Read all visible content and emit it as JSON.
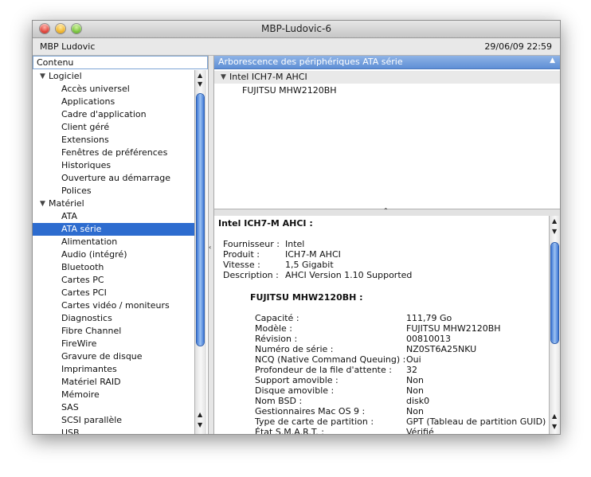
{
  "window": {
    "title": "MBP-Ludovic-6",
    "machine_name": "MBP Ludovic",
    "datetime": "29/06/09 22:59"
  },
  "sidebar": {
    "header": "Contenu",
    "groups": [
      {
        "label": "Logiciel",
        "items": [
          "Accès universel",
          "Applications",
          "Cadre d'application",
          "Client géré",
          "Extensions",
          "Fenêtres de préférences",
          "Historiques",
          "Ouverture au démarrage",
          "Polices"
        ]
      },
      {
        "label": "Matériel",
        "items": [
          "ATA",
          "ATA série",
          "Alimentation",
          "Audio (intégré)",
          "Bluetooth",
          "Cartes PC",
          "Cartes PCI",
          "Cartes vidéo / moniteurs",
          "Diagnostics",
          "Fibre Channel",
          "FireWire",
          "Gravure de disque",
          "Imprimantes",
          "Matériel RAID",
          "Mémoire",
          "SAS",
          "SCSI parallèle",
          "USB"
        ]
      }
    ],
    "selected": "ATA série"
  },
  "top_pane": {
    "header": "Arborescence des périphériques ATA série",
    "controller": "Intel ICH7-M AHCI",
    "device": "FUJITSU MHW2120BH"
  },
  "detail": {
    "title": "Intel ICH7-M AHCI :",
    "controller_props": [
      {
        "label": "Fournisseur :",
        "value": "Intel"
      },
      {
        "label": "Produit :",
        "value": "ICH7-M AHCI"
      },
      {
        "label": "Vitesse :",
        "value": "1,5 Gigabit"
      },
      {
        "label": "Description :",
        "value": "AHCI Version 1.10 Supported"
      }
    ],
    "device_title": "FUJITSU MHW2120BH :",
    "device_props": [
      {
        "label": "Capacité :",
        "value": "111,79 Go"
      },
      {
        "label": "Modèle :",
        "value": "FUJITSU MHW2120BH"
      },
      {
        "label": "Révision :",
        "value": "00810013"
      },
      {
        "label": "Numéro de série :",
        "value": "NZ0ST6A25NKU"
      },
      {
        "label": "NCQ (Native Command Queuing) :",
        "value": "Oui"
      },
      {
        "label": "Profondeur de la file d'attente :",
        "value": "32"
      },
      {
        "label": "Support amovible :",
        "value": "Non"
      },
      {
        "label": "Disque amovible :",
        "value": "Non"
      },
      {
        "label": "Nom BSD :",
        "value": "disk0"
      },
      {
        "label": "Gestionnaires Mac OS 9 :",
        "value": "Non"
      },
      {
        "label": "Type de carte de partition :",
        "value": "GPT (Tableau de partition GUID)"
      },
      {
        "label": "État S.M.A.R.T. :",
        "value": "Vérifié"
      }
    ]
  }
}
